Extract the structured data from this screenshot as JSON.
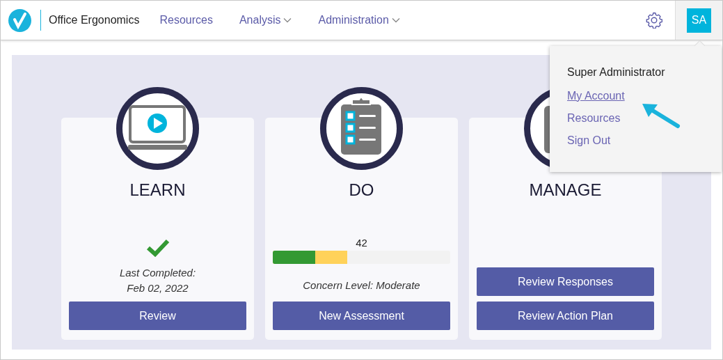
{
  "header": {
    "app_title": "Office Ergonomics",
    "nav": [
      {
        "label": "Resources",
        "has_menu": false
      },
      {
        "label": "Analysis",
        "has_menu": true
      },
      {
        "label": "Administration",
        "has_menu": true
      }
    ],
    "avatar": "SA"
  },
  "cards": [
    {
      "title": "LEARN",
      "kind": "completed",
      "lines": [
        "Last Completed:",
        "Feb 02, 2022"
      ],
      "buttons": [
        "Review"
      ]
    },
    {
      "title": "DO",
      "kind": "score",
      "score": "42",
      "fills": [
        {
          "color": "#ffd25a",
          "level": 0.42
        },
        {
          "color": "#339933",
          "level": 0.24
        }
      ],
      "caption": "Concern Level: Moderate",
      "buttons": [
        "New Assessment"
      ]
    },
    {
      "title": "MANAGE",
      "kind": "actions",
      "buttons": [
        "Review Responses",
        "Review Action Plan"
      ]
    }
  ],
  "user_menu": {
    "name": "Super Administrator",
    "items": [
      {
        "label": "My Account",
        "selected": true
      },
      {
        "label": "Resources",
        "selected": false
      },
      {
        "label": "Sign Out",
        "selected": false
      }
    ]
  }
}
